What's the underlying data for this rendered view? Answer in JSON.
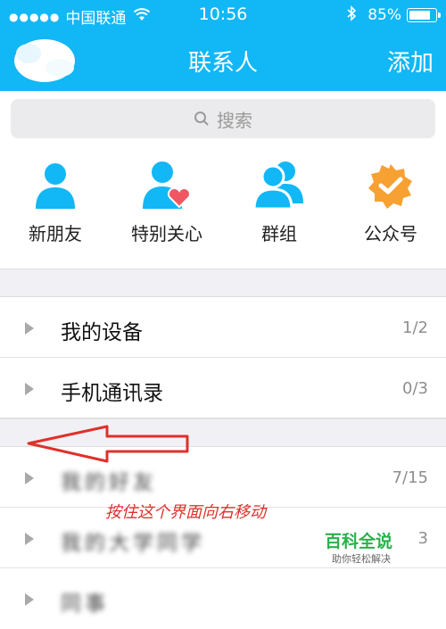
{
  "status_bar": {
    "signal_dots": "●●●●●",
    "carrier": "中国联通",
    "time": "10:56",
    "battery_percent": "85%",
    "battery_level": 0.85
  },
  "header": {
    "title": "联系人",
    "add_label": "添加"
  },
  "search": {
    "placeholder": "搜索"
  },
  "shortcuts": [
    {
      "label": "新朋友",
      "icon": "person-icon"
    },
    {
      "label": "特别关心",
      "icon": "person-heart-icon"
    },
    {
      "label": "群组",
      "icon": "group-icon"
    },
    {
      "label": "公众号",
      "icon": "verified-badge-icon"
    }
  ],
  "groups": [
    {
      "label": "我的设备",
      "count": "1/2"
    },
    {
      "label": "手机通讯录",
      "count": "0/3"
    },
    {
      "label": "我的好友",
      "count": "7/15"
    },
    {
      "label": "我的大学同学",
      "count": "3"
    },
    {
      "label": "同事",
      "count": ""
    }
  ],
  "annotation": {
    "instruction": "按住这个界面向右移动"
  },
  "watermark": {
    "title": "百科全说",
    "subtitle": "助你轻松解决"
  },
  "colors": {
    "header_bg": "#12b7f5",
    "accent_red": "#e0302b",
    "watermark_green": "#2bb04b"
  }
}
